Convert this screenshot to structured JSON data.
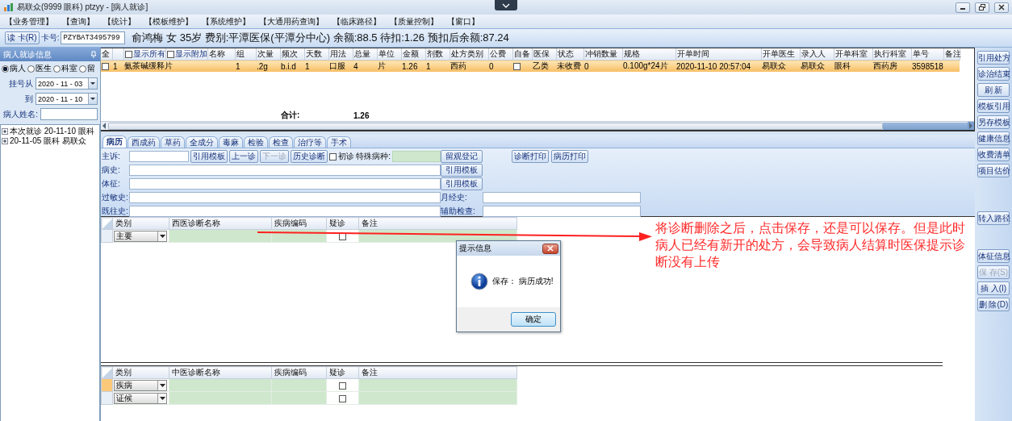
{
  "window": {
    "title": "易联众(9999 眼科) ptzyy - [病人就诊]"
  },
  "menu": [
    "【业务管理】",
    "【查询】",
    "【统计】",
    "【模板维护】",
    "【系统维护】",
    "【大通用药查询】",
    "【临床路径】",
    "【质量控制】",
    "【窗口】"
  ],
  "patient_bar": {
    "read_card_button": "读 卡(R)",
    "card_label": "卡号:",
    "card_number": "PZYBAT3495799",
    "info": "俞鸿梅  女  35岁  费别:平潭医保(平潭分中心) 余额:88.5 待扣:1.26 预扣后余额:87.24"
  },
  "sidebar": {
    "title": "病人就诊信息",
    "filters": [
      {
        "label": "病人",
        "selected": true
      },
      {
        "label": "医生",
        "selected": false
      },
      {
        "label": "科室",
        "selected": false
      },
      {
        "label": "留",
        "selected": false
      }
    ],
    "date_from": {
      "label": "挂号从",
      "value": "2020 - 11 - 03"
    },
    "date_to": {
      "label": "到",
      "value": "2020 - 11 - 10"
    },
    "name_label": "病人姓名:",
    "visits": [
      "本次就诊 20-11-10 眼科",
      "20-11-05 眼科 易联众"
    ]
  },
  "prescriptions": {
    "columns": [
      {
        "kind": "text",
        "label": "全"
      },
      {
        "kind": "blank"
      },
      {
        "kind": "option",
        "label": "显示所有",
        "checked": false
      },
      {
        "kind": "option",
        "label": "显示附加",
        "checked": false
      },
      {
        "kind": "name",
        "label": "名称"
      },
      {
        "kind": "text",
        "label": "组"
      },
      {
        "kind": "text",
        "label": "次量"
      },
      {
        "kind": "text",
        "label": "频次"
      },
      {
        "kind": "text",
        "label": "天数"
      },
      {
        "kind": "text",
        "label": "用法"
      },
      {
        "kind": "text",
        "label": "总量"
      },
      {
        "kind": "text",
        "label": "单位"
      },
      {
        "kind": "text",
        "label": "金额"
      },
      {
        "kind": "text",
        "label": "剂数"
      },
      {
        "kind": "text",
        "label": "处方类别"
      },
      {
        "kind": "text",
        "label": "公费"
      },
      {
        "kind": "text",
        "label": "自备"
      },
      {
        "kind": "text",
        "label": "医保"
      },
      {
        "kind": "text",
        "label": "状态"
      },
      {
        "kind": "text",
        "label": "冲销数量"
      },
      {
        "kind": "text",
        "label": "规格"
      },
      {
        "kind": "text",
        "label": "开单时间"
      },
      {
        "kind": "text",
        "label": "开单医生"
      },
      {
        "kind": "text",
        "label": "录入人"
      },
      {
        "kind": "text",
        "label": "开单科室"
      },
      {
        "kind": "text",
        "label": "执行科室"
      },
      {
        "kind": "text",
        "label": "单号"
      },
      {
        "kind": "text",
        "label": "备注"
      }
    ],
    "rows": [
      {
        "selected": true,
        "cells": [
          {
            "kind": "check",
            "checked": false
          },
          {
            "kind": "text",
            "text": "1"
          },
          {
            "kind": "name",
            "text": "氨茶碱缓释片"
          },
          {
            "kind": "empty"
          },
          {
            "kind": "empty"
          },
          {
            "kind": "text",
            "text": "1"
          },
          {
            "kind": "text",
            "text": ".2g"
          },
          {
            "kind": "text",
            "text": "b.i.d"
          },
          {
            "kind": "text",
            "text": "1"
          },
          {
            "kind": "text",
            "text": "口服"
          },
          {
            "kind": "text",
            "text": "4"
          },
          {
            "kind": "text",
            "text": "片"
          },
          {
            "kind": "text",
            "text": "1.26"
          },
          {
            "kind": "text",
            "text": "1"
          },
          {
            "kind": "text",
            "text": "西药"
          },
          {
            "kind": "text",
            "text": "0"
          },
          {
            "kind": "check",
            "checked": false
          },
          {
            "kind": "text",
            "text": "乙类"
          },
          {
            "kind": "text",
            "text": "未收费"
          },
          {
            "kind": "text",
            "text": "0"
          },
          {
            "kind": "text",
            "text": "0.100g*24片"
          },
          {
            "kind": "text",
            "text": "2020-11-10 20:57:04"
          },
          {
            "kind": "text",
            "text": "易联众"
          },
          {
            "kind": "text",
            "text": "易联众"
          },
          {
            "kind": "text",
            "text": "眼科"
          },
          {
            "kind": "text",
            "text": "西药房"
          },
          {
            "kind": "text",
            "text": "3598518"
          }
        ]
      }
    ],
    "total": {
      "label": "合计:",
      "amount": "1.26"
    }
  },
  "tabs": [
    {
      "label": "病历",
      "selected": true
    },
    {
      "label": "西成药",
      "selected": false
    },
    {
      "label": "草药",
      "selected": false
    },
    {
      "label": "全成分",
      "selected": false
    },
    {
      "label": "毒麻",
      "selected": false
    },
    {
      "label": "检验",
      "selected": false
    },
    {
      "label": "检查",
      "selected": false
    },
    {
      "label": "治疗等",
      "selected": false
    },
    {
      "label": "手术",
      "selected": false
    }
  ],
  "record_form": {
    "chief_complaint": {
      "label": "主诉:",
      "buttons": [
        {
          "label": "引用模板",
          "disabled": false
        },
        {
          "label": "上一诊",
          "disabled": false
        },
        {
          "label": "下一诊",
          "disabled": true
        },
        {
          "label": "历史诊断",
          "disabled": false
        }
      ],
      "first_visit": {
        "label": "初诊",
        "checked": false
      },
      "special_disease_label": "特殊病种:",
      "register_button": "留观登记",
      "print_buttons": [
        "诊断打印",
        "病历打印"
      ]
    },
    "history": {
      "label": "病史:",
      "button": "引用模板"
    },
    "signs": {
      "label": "体征:",
      "button": "引用模板"
    },
    "allergy": {
      "label": "过敏史:"
    },
    "menstrual": {
      "label": "月经史:"
    },
    "past_history": {
      "label": "既往史:"
    },
    "auxiliary_exam": {
      "label": "辅助检查:"
    }
  },
  "western_diagnosis": {
    "columns": [
      "类别",
      "西医诊断名称",
      "疾病编码",
      "疑诊",
      "备注"
    ],
    "rows": [
      {
        "category": "主要",
        "suspected": false,
        "selected": false
      }
    ]
  },
  "tcm_diagnosis": {
    "columns": [
      "类别",
      "中医诊断名称",
      "疾病编码",
      "疑诊",
      "备注"
    ],
    "rows": [
      {
        "category": "疾病",
        "suspected": false,
        "selected": true
      },
      {
        "category": "证候",
        "suspected": false,
        "selected": false
      }
    ]
  },
  "side_buttons": [
    [
      {
        "label": "引用处方",
        "disabled": false
      },
      {
        "label": "诊治结束",
        "disabled": false
      },
      {
        "label": "刷 新",
        "disabled": false
      },
      {
        "label": "模板引用",
        "disabled": false
      },
      {
        "label": "另存模板",
        "disabled": false
      },
      {
        "label": "健康信息",
        "disabled": false
      },
      {
        "label": "收费清单",
        "disabled": false
      },
      {
        "label": "项目估价",
        "disabled": false
      }
    ],
    [
      {
        "label": "转入路径",
        "disabled": false
      }
    ],
    [
      {
        "label": "体征信息",
        "disabled": false
      },
      {
        "label": "保 存(S)",
        "disabled": true
      },
      {
        "label": "插 入(I)",
        "disabled": false
      },
      {
        "label": "删 除(D)",
        "disabled": false
      }
    ]
  ],
  "annotation": {
    "text": "将诊断删除之后，点击保存，还是可以保存。但是此时病人已经有新开的处方，会导致病人结算时医保提示诊断没有上传"
  },
  "dialog": {
    "title": "提示信息",
    "message": "保存：  病历成功!",
    "ok_button": "确定"
  }
}
